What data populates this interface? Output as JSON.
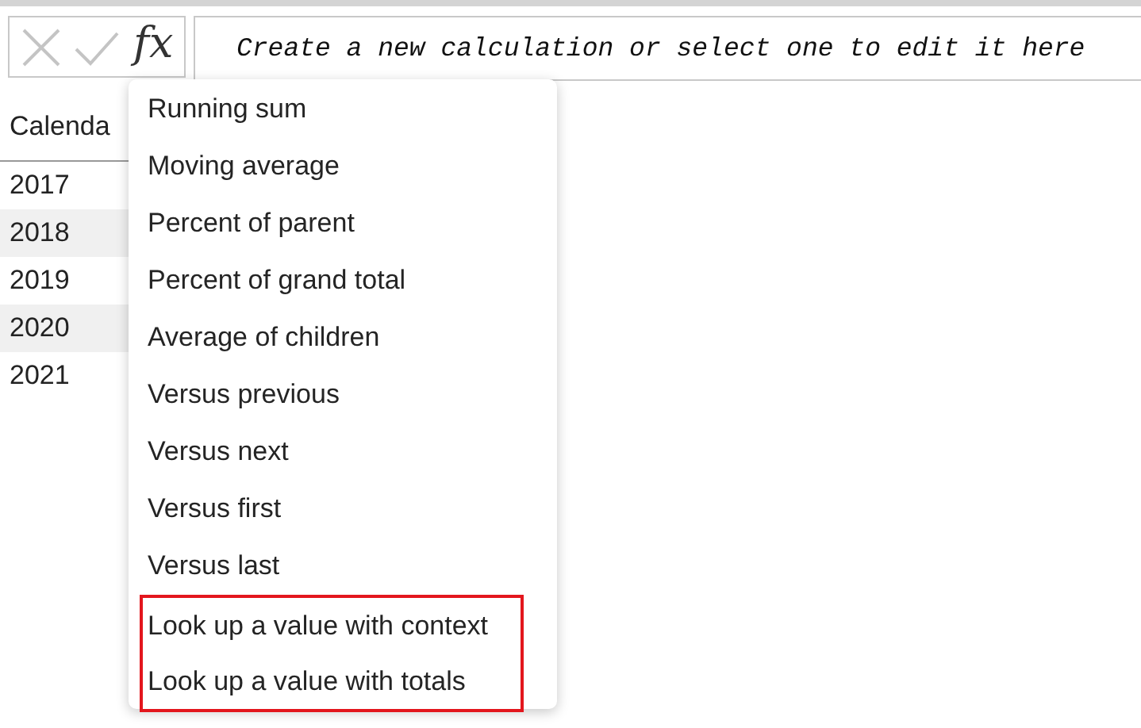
{
  "formula_bar": {
    "fx_label": "fx",
    "placeholder": "Create a new calculation or select one to edit it here"
  },
  "table": {
    "column_header": "Calenda",
    "rows": [
      {
        "value": "2017",
        "shaded": false
      },
      {
        "value": "2018",
        "shaded": true
      },
      {
        "value": "2019",
        "shaded": false
      },
      {
        "value": "2020",
        "shaded": true
      },
      {
        "value": "2021",
        "shaded": false
      }
    ]
  },
  "menu": {
    "items": [
      {
        "label": "Running sum",
        "highlighted": false
      },
      {
        "label": "Moving average",
        "highlighted": false
      },
      {
        "label": "Percent of parent",
        "highlighted": false
      },
      {
        "label": "Percent of grand total",
        "highlighted": false
      },
      {
        "label": "Average of children",
        "highlighted": false
      },
      {
        "label": "Versus previous",
        "highlighted": false
      },
      {
        "label": "Versus next",
        "highlighted": false
      },
      {
        "label": "Versus first",
        "highlighted": false
      },
      {
        "label": "Versus last",
        "highlighted": false
      },
      {
        "label": "Look up a value with context",
        "highlighted": true
      },
      {
        "label": "Look up a value with totals",
        "highlighted": true
      }
    ]
  }
}
